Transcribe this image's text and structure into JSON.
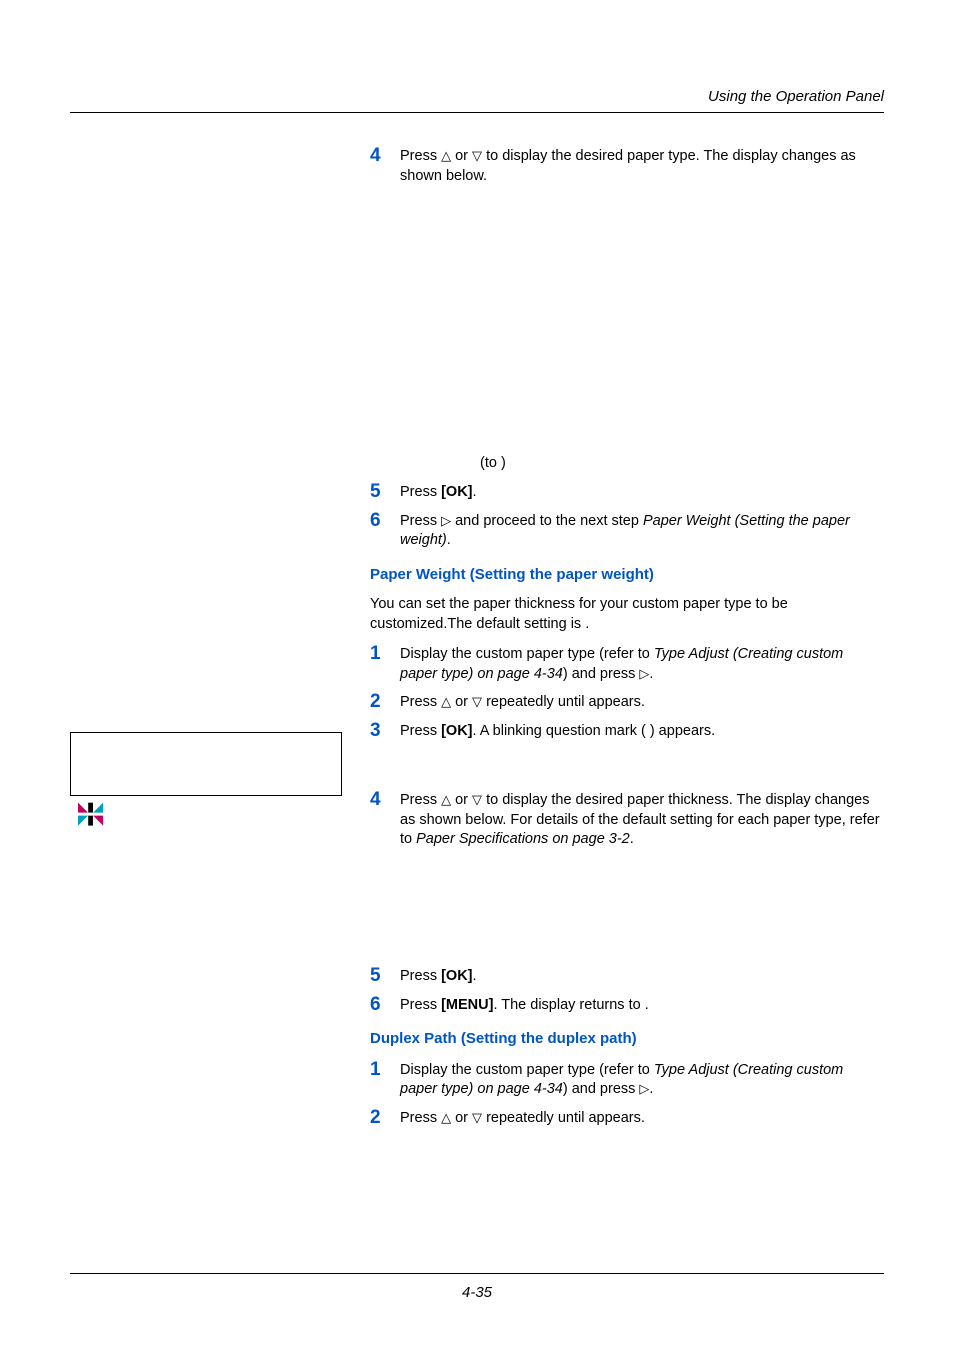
{
  "header": {
    "section": "Using the Operation Panel"
  },
  "footer": {
    "page": "4-35"
  },
  "blockA": {
    "step4_a": "Press ",
    "step4_b": " or ",
    "step4_c": " to display the desired paper type. The display changes as shown below.",
    "to": "(to   )",
    "step5_a": "Press ",
    "step5_ok": "[OK]",
    "step5_b": ".",
    "step6_a": "Press ",
    "step6_b": " and proceed to the next step ",
    "step6_ref": "Paper Weight (Setting the paper weight)",
    "step6_c": "."
  },
  "sectionB": {
    "title": "Paper Weight (Setting the paper weight)",
    "body": "You can set the paper thickness for your custom paper type to be customized.The default setting is              .",
    "step1_a": "Display the custom paper type (refer to ",
    "step1_ref": "Type Adjust (Creating custom paper type) on page 4-34",
    "step1_b": ") and press ",
    "step1_c": ".",
    "step2_a": "Press ",
    "step2_b": " or ",
    "step2_c": " repeatedly until                                   appears.",
    "step3_a": "Press ",
    "step3_ok": "[OK]",
    "step3_b": ". A blinking question mark (  ) appears.",
    "step4_a": "Press ",
    "step4_b": " or ",
    "step4_c": " to display the desired paper thickness. The display changes as shown below. For details of the default setting for each paper type, refer to ",
    "step4_ref": "Paper Specifications on page 3-2",
    "step4_d": ".",
    "step5_a": "Press ",
    "step5_ok": "[OK]",
    "step5_b": ".",
    "step6_a": "Press ",
    "step6_menu": "[MENU]",
    "step6_b": ". The display returns to              ."
  },
  "sectionC": {
    "title": "Duplex Path (Setting the duplex path)",
    "step1_a": "Display the custom paper type (refer to ",
    "step1_ref": "Type Adjust (Creating custom paper type) on page 4-34",
    "step1_b": ") and press ",
    "step1_c": ".",
    "step2_a": "Press ",
    "step2_b": " or ",
    "step2_c": " repeatedly until                              appears."
  },
  "nums": {
    "n1": "1",
    "n2": "2",
    "n3": "3",
    "n4": "4",
    "n5": "5",
    "n6": "6"
  },
  "glyphs": {
    "up": "△",
    "down": "▽",
    "right": "▷"
  },
  "sideglyph": {
    "r1a": "◣",
    "r1b": "▮",
    "r1c": "◢",
    "r2a": "◤",
    "r2b": "▮",
    "r2c": "◥"
  }
}
